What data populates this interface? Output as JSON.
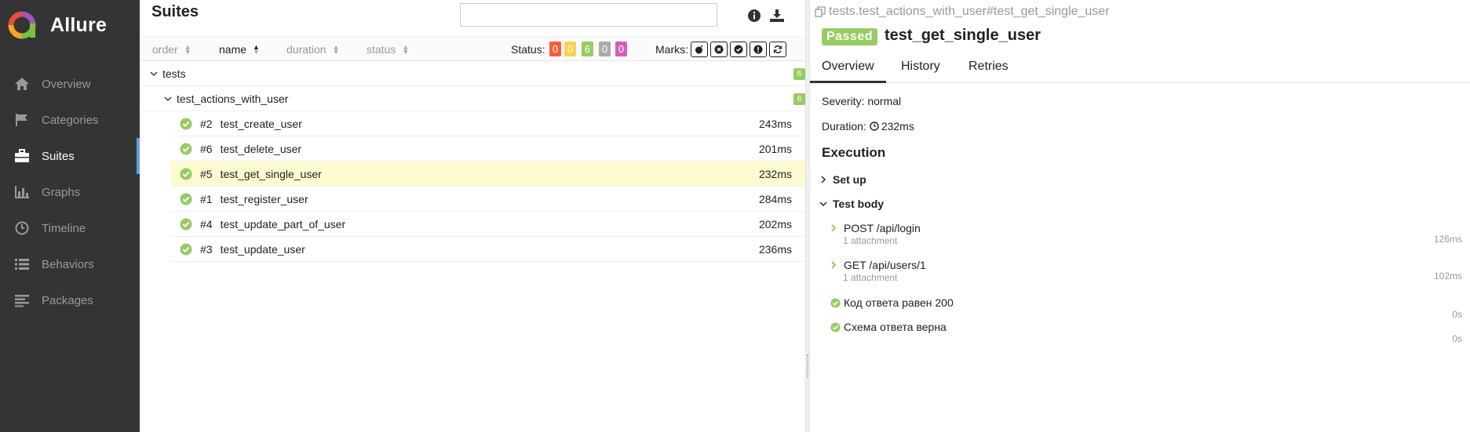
{
  "app": {
    "name": "Allure",
    "colors": {
      "sidebar": "#343434",
      "accent": "#5fa2dd",
      "passed": "#97cc64",
      "selected_row": "#fffbd0"
    }
  },
  "sidebar": {
    "items": [
      {
        "label": "Overview",
        "icon": "home-icon"
      },
      {
        "label": "Categories",
        "icon": "flag-icon"
      },
      {
        "label": "Suites",
        "icon": "briefcase-icon",
        "active": true
      },
      {
        "label": "Graphs",
        "icon": "bar-chart-icon"
      },
      {
        "label": "Timeline",
        "icon": "clock-icon"
      },
      {
        "label": "Behaviors",
        "icon": "list-icon"
      },
      {
        "label": "Packages",
        "icon": "align-left-icon"
      }
    ]
  },
  "suites": {
    "title": "Suites",
    "search_value": "",
    "sort": [
      {
        "label": "order"
      },
      {
        "label": "name",
        "active": true
      },
      {
        "label": "duration"
      },
      {
        "label": "status"
      }
    ],
    "status_label": "Status:",
    "status_counts": [
      {
        "status": "failed",
        "count": "0",
        "color": "#fd5a3e"
      },
      {
        "status": "broken",
        "count": "0",
        "color": "#ffd050"
      },
      {
        "status": "passed",
        "count": "6",
        "color": "#97cc64"
      },
      {
        "status": "skipped",
        "count": "0",
        "color": "#aaaaaa"
      },
      {
        "status": "unknown",
        "count": "0",
        "color": "#d35ebe"
      }
    ],
    "marks_label": "Marks:",
    "tree": {
      "root": {
        "name": "tests",
        "count": "6"
      },
      "group": {
        "name": "test_actions_with_user",
        "count": "6"
      },
      "rows": [
        {
          "num": "#2",
          "name": "test_create_user",
          "duration": "243ms"
        },
        {
          "num": "#6",
          "name": "test_delete_user",
          "duration": "201ms"
        },
        {
          "num": "#5",
          "name": "test_get_single_user",
          "duration": "232ms",
          "selected": true
        },
        {
          "num": "#1",
          "name": "test_register_user",
          "duration": "284ms"
        },
        {
          "num": "#4",
          "name": "test_update_part_of_user",
          "duration": "202ms"
        },
        {
          "num": "#3",
          "name": "test_update_user",
          "duration": "236ms"
        }
      ]
    }
  },
  "test": {
    "full_name": "tests.test_actions_with_user#test_get_single_user",
    "status": "Passed",
    "title": "test_get_single_user",
    "tabs": [
      "Overview",
      "History",
      "Retries"
    ],
    "severity": "Severity: normal",
    "duration_label": "Duration:",
    "duration_value": "232ms",
    "execution": "Execution",
    "setup": "Set up",
    "body": "Test body",
    "steps": [
      {
        "name": "POST /api/login",
        "attachments": "1 attachment",
        "duration": "126ms"
      },
      {
        "name": "GET /api/users/1",
        "attachments": "1 attachment",
        "duration": "102ms"
      },
      {
        "name": "Код ответа равен 200",
        "duration": "0s"
      },
      {
        "name": "Схема ответа верна",
        "duration": "0s"
      }
    ]
  }
}
